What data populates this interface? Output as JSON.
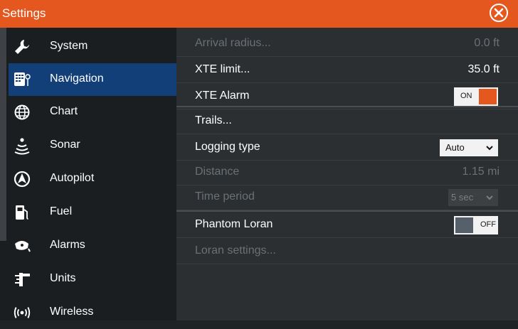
{
  "window": {
    "title": "Settings"
  },
  "sidebar": {
    "items": [
      {
        "label": "System",
        "icon": "wrench-icon"
      },
      {
        "label": "Navigation",
        "icon": "navigation-icon"
      },
      {
        "label": "Chart",
        "icon": "globe-icon"
      },
      {
        "label": "Sonar",
        "icon": "sonar-icon"
      },
      {
        "label": "Autopilot",
        "icon": "autopilot-icon"
      },
      {
        "label": "Fuel",
        "icon": "fuel-icon"
      },
      {
        "label": "Alarms",
        "icon": "alarm-icon"
      },
      {
        "label": "Units",
        "icon": "units-icon"
      },
      {
        "label": "Wireless",
        "icon": "wireless-icon"
      }
    ],
    "selected": "Navigation"
  },
  "navigation": {
    "arrival_radius": {
      "label": "Arrival radius...",
      "value": "0.0 ft"
    },
    "xte_limit": {
      "label": "XTE limit...",
      "value": "35.0 ft"
    },
    "xte_alarm": {
      "label": "XTE Alarm",
      "toggle": "ON"
    },
    "trails": {
      "label": "Trails..."
    },
    "logging_type": {
      "label": "Logging type",
      "value": "Auto"
    },
    "distance": {
      "label": "Distance",
      "value": "1.15 mi"
    },
    "time_period": {
      "label": "Time period",
      "value": "5 sec"
    },
    "phantom_loran": {
      "label": "Phantom Loran",
      "toggle": "OFF"
    },
    "loran_settings": {
      "label": "Loran settings..."
    }
  },
  "colors": {
    "accent": "#e4571f",
    "selected": "#123f78",
    "background": "#2b2f32"
  }
}
